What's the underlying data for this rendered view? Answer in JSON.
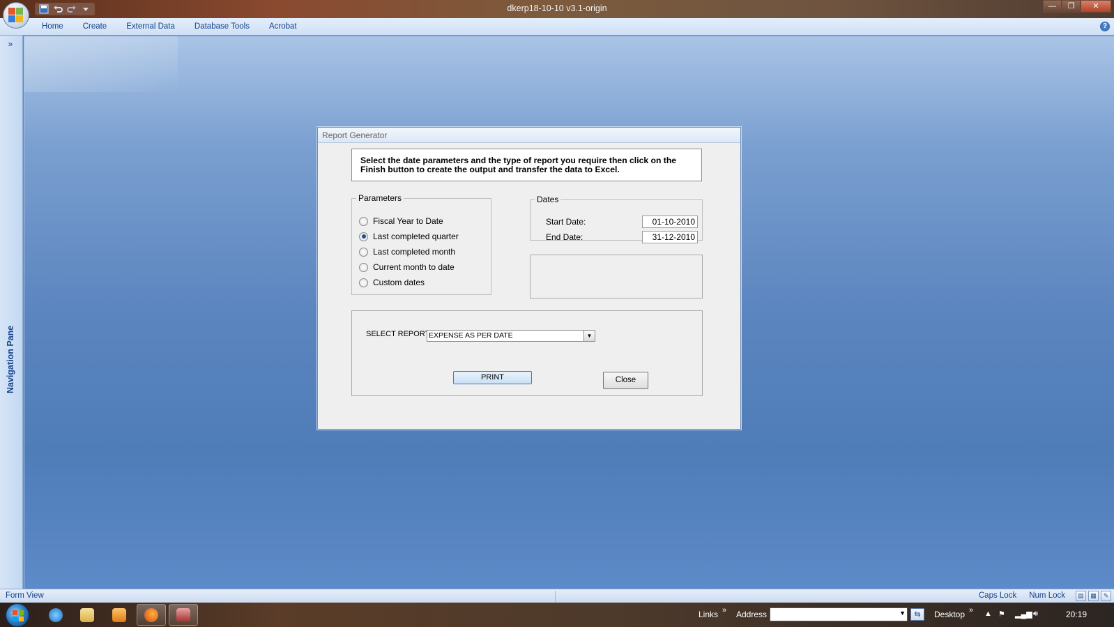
{
  "window": {
    "title": "dkerp18-10-10 v3.1-origin",
    "controls": {
      "minimize": "—",
      "restore": "❐",
      "close": "✕"
    }
  },
  "quick_access": {
    "icons": [
      "save-icon",
      "undo-icon",
      "redo-icon",
      "customize-icon"
    ]
  },
  "ribbon": {
    "tabs": [
      "Home",
      "Create",
      "External Data",
      "Database Tools",
      "Acrobat"
    ],
    "help": "?"
  },
  "navigation_pane": {
    "toggle": "»",
    "label": "Navigation Pane"
  },
  "dialog": {
    "title": "Report Generator",
    "instructions": "Select the date parameters and the type of report you require then click on the Finish button to create the output and transfer the data to Excel.",
    "parameters": {
      "legend": "Parameters",
      "options": [
        {
          "label": "Fiscal Year to Date",
          "selected": false
        },
        {
          "label": "Last completed quarter",
          "selected": true
        },
        {
          "label": "Last completed month",
          "selected": false
        },
        {
          "label": "Current month to date",
          "selected": false
        },
        {
          "label": "Custom dates",
          "selected": false
        }
      ]
    },
    "dates": {
      "legend": "Dates",
      "start_label": "Start Date:",
      "start_value": "01-10-2010",
      "end_label": "End Date:",
      "end_value": "31-12-2010"
    },
    "report": {
      "select_label": "SELECT REPORT",
      "selected_value": "EXPENSE AS PER DATE",
      "print_label": "PRINT",
      "close_label": "Close"
    }
  },
  "status_bar": {
    "mode": "Form View",
    "caps_lock": "Caps Lock",
    "num_lock": "Num Lock"
  },
  "taskbar": {
    "links": "Links",
    "address_label": "Address",
    "address_value": "",
    "desktop": "Desktop",
    "chevron": "»",
    "clock": "20:19"
  }
}
